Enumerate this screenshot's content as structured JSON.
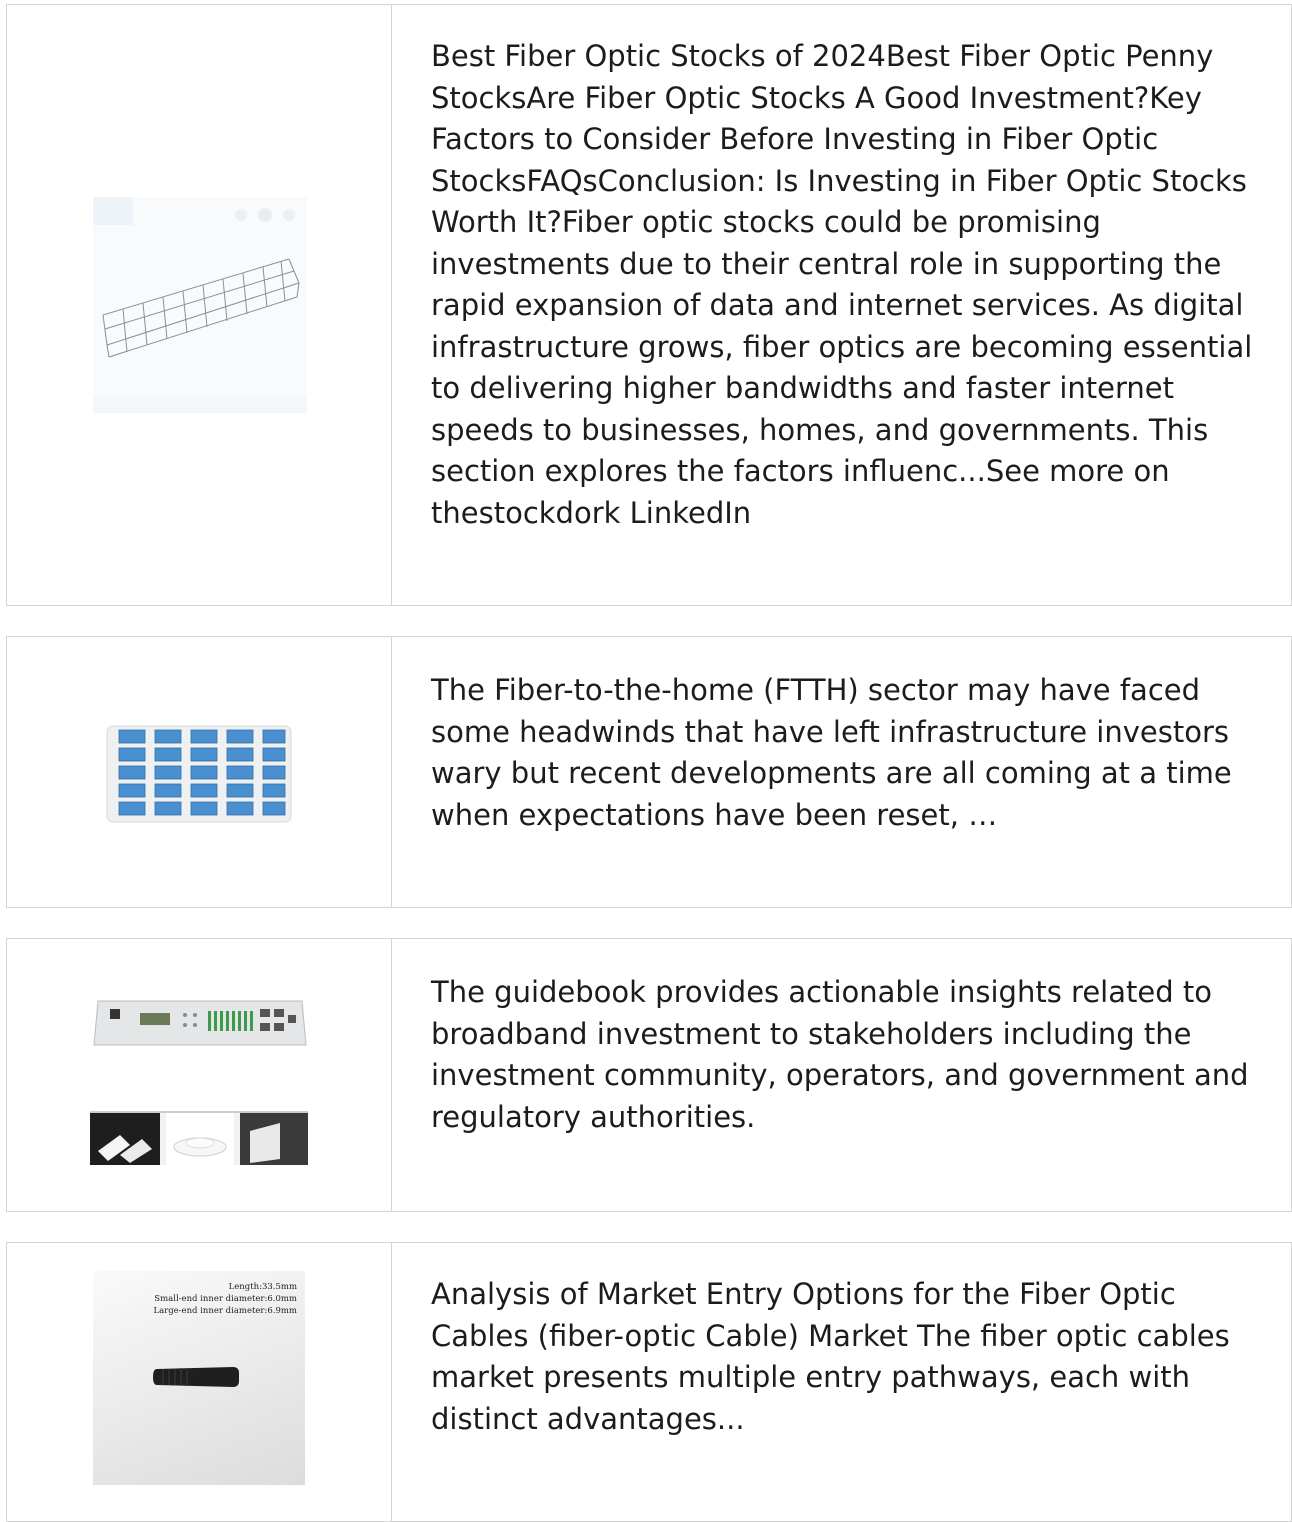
{
  "results": [
    {
      "image_name": "wire-cable-tray-image",
      "text": "Best Fiber Optic Stocks of 2024Best Fiber Optic Penny StocksAre Fiber Optic Stocks A Good Investment?Key Factors to Consider Before Investing in Fiber Optic StocksFAQsConclusion: Is Investing in Fiber Optic Stocks Worth It?Fiber optic stocks could be promising investments due to their central role in supporting the rapid expansion of data and internet services. As digital infrastructure grows, fiber optics are becoming essential to delivering higher bandwidths and faster internet speeds to businesses, homes, and governments. This section explores the factors influenc...See more on thestockdork LinkedIn"
    },
    {
      "image_name": "fiber-adapter-tray-image",
      "text": "The Fiber-to-the-home (FTTH) sector may have faced some headwinds that have left infrastructure investors wary but recent developments are all coming at a time when expectations have been reset, …"
    },
    {
      "image_name": "rack-alarm-panel-image",
      "text": "The guidebook provides actionable insights related to broadband investment to stakeholders including the investment community, operators, and government and regulatory authorities."
    },
    {
      "image_name": "cable-boot-image",
      "image_caption": [
        "Length:33.5mm",
        "Small-end inner diameter:6.0mm",
        "Large-end inner diameter:6.9mm"
      ],
      "text": "Analysis of Market Entry Options for the Fiber Optic Cables (fiber-optic Cable) Market The fiber optic cables market presents multiple entry pathways, each with distinct advantages..."
    }
  ],
  "colors": {
    "border": "#d4d4d4",
    "text": "#1c1c1c",
    "adapter_blue": "#4a8fcf"
  }
}
